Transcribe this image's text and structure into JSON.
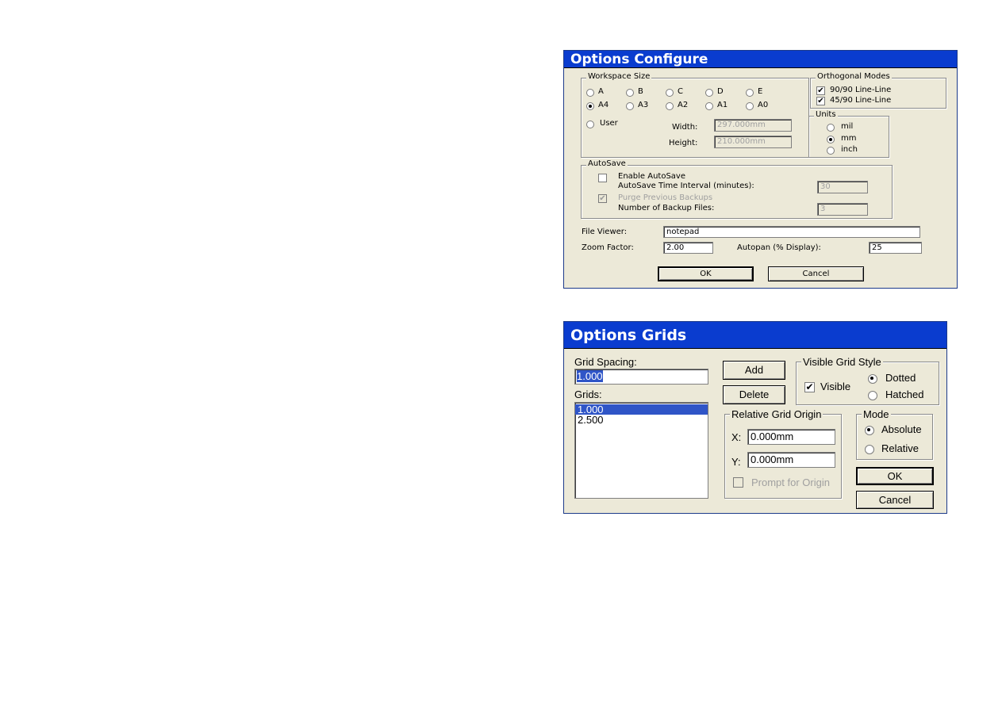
{
  "configure": {
    "title": "Options Configure",
    "workspace_size": {
      "legend": "Workspace Size",
      "row1": [
        "A",
        "B",
        "C",
        "D",
        "E"
      ],
      "row2": [
        "A4",
        "A3",
        "A2",
        "A1",
        "A0"
      ],
      "selected": "A4",
      "user_label": "User",
      "width_label": "Width:",
      "width_value": "297.000mm",
      "height_label": "Height:",
      "height_value": "210.000mm"
    },
    "orthogonal_modes": {
      "legend": "Orthogonal Modes",
      "items": [
        {
          "label": "90/90  Line-Line",
          "checked": true
        },
        {
          "label": "45/90  Line-Line",
          "checked": true
        }
      ]
    },
    "units": {
      "legend": "Units",
      "items": [
        "mil",
        "mm",
        "inch"
      ],
      "selected": "mm"
    },
    "autosave": {
      "legend": "AutoSave",
      "enable_label": "Enable AutoSave",
      "interval_label": "AutoSave Time Interval (minutes):",
      "interval_value": "30",
      "purge_label": "Purge Previous Backups",
      "backup_label": "Number of Backup Files:",
      "backup_value": "3"
    },
    "file_viewer_label": "File Viewer:",
    "file_viewer_value": "notepad",
    "zoom_label": "Zoom Factor:",
    "zoom_value": "2.00",
    "autopan_label": "Autopan (% Display):",
    "autopan_value": "25",
    "ok_label": "OK",
    "cancel_label": "Cancel"
  },
  "grids": {
    "title": "Options Grids",
    "spacing_label": "Grid Spacing:",
    "spacing_value": "1.000",
    "grids_label": "Grids:",
    "grids_list": [
      "1.000",
      "2.500"
    ],
    "selected_index": 0,
    "add_label": "Add",
    "delete_label": "Delete",
    "visible_style": {
      "legend": "Visible Grid Style",
      "visible_label": "Visible",
      "visible_checked": true,
      "options": [
        "Dotted",
        "Hatched"
      ],
      "selected": "Dotted"
    },
    "origin": {
      "legend": "Relative Grid Origin",
      "x_label": "X:",
      "x_value": "0.000mm",
      "y_label": "Y:",
      "y_value": "0.000mm",
      "prompt_label": "Prompt for Origin"
    },
    "mode": {
      "legend": "Mode",
      "options": [
        "Absolute",
        "Relative"
      ],
      "selected": "Absolute"
    },
    "ok_label": "OK",
    "cancel_label": "Cancel"
  }
}
